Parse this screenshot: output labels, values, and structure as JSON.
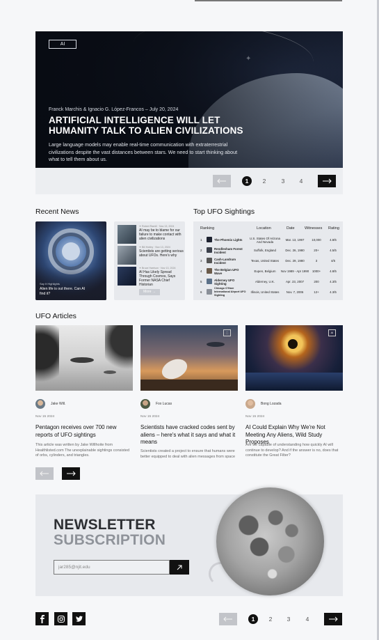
{
  "hero": {
    "tag": "AI",
    "byline": "Franck Marchis & Ignacio G. López-Francos – July 20, 2024",
    "title": "ARTIFICIAL INTELLIGENCE WILL LET HUMANITY TALK TO ALIEN CIVILIZATIONS",
    "description": "Large language models may enable real-time communication with extraterrestrial civilizations despite the vast distances between stars. We need to start thinking about what to tell them about us."
  },
  "pager_top": {
    "pages": [
      "1",
      "2",
      "3",
      "4"
    ],
    "active": "1"
  },
  "recent_news": {
    "title": "Recent News",
    "main": {
      "meta": "Say It Highlights",
      "title": "Alien life is out there. Can AI find it?"
    },
    "items": [
      {
        "meta": "✦ Robert Ramili · Nov 13, 2024",
        "title": "AI may be to blame for our failure to make contact with alien civilizations"
      },
      {
        "meta": "✦ Bill Hobby · Nov 13, 2024",
        "title": "Scientists are getting serious about UFOs. Here's why"
      },
      {
        "meta": "✦ Bruce Harrison · Nov 13, 2024",
        "title": "AI Has Likely Spread Through Cosmos, Says Former NASA Chief Historian"
      }
    ],
    "more_label": "More →"
  },
  "top_ufo": {
    "title": "Top UFO Sightings",
    "headers": {
      "ranking": "Ranking",
      "location": "Location",
      "date": "Date",
      "witnesses": "Witnesses",
      "rating": "Rating"
    },
    "rows": [
      {
        "num": "1",
        "name": "The Phoenix Lights",
        "location": "U.S. States Of Arizona And Nevada",
        "date": "Mar. 13, 1997",
        "witnesses": "10,000",
        "rating": "4.8/5"
      },
      {
        "num": "2",
        "name": "Rendlesham Forest Incident",
        "location": "Suffolk, England",
        "date": "Dec. 26, 1980",
        "witnesses": "20+",
        "rating": "4.5/5"
      },
      {
        "num": "3",
        "name": "Cash-Landrum Incident",
        "location": "Texas, United States",
        "date": "Dec. 29, 1980",
        "witnesses": "3",
        "rating": "4/5"
      },
      {
        "num": "4",
        "name": "The Belgian UFO Wave",
        "location": "Eupen, Belgium",
        "date": "Nov 1989 - Apr 1990",
        "witnesses": "1000+",
        "rating": "4.8/5"
      },
      {
        "num": "5",
        "name": "Alderney UFO Sighting",
        "location": "Alderney, U.K.",
        "date": "Apr. 23, 2007",
        "witnesses": "200",
        "rating": "4.3/5"
      },
      {
        "num": "6",
        "name": "Chicago O'Hare International Airport UFO Sighting",
        "location": "Illinois, United States",
        "date": "Nov. 7, 2006",
        "witnesses": "12+",
        "rating": "4.3/5"
      }
    ]
  },
  "articles": {
    "title": "UFO Articles",
    "items": [
      {
        "badge": "",
        "author": "Jake Will.",
        "date": "Nov 15 2024",
        "title": "Pentagon receives over 700 new reports of UFO sightings",
        "excerpt": "This article was written by Jake Willhoite from Healthlisted.com The unexplainable sightings consisted of orbs, cylinders, and triangles."
      },
      {
        "badge": "⬚",
        "author": "Fox Lucas",
        "date": "Nov 15 2024",
        "title": "Scientists have cracked codes sent by aliens – here's what it says and what it means",
        "excerpt": "Scientists created a project to ensure that humans were better equipped to deal with alien messages from space"
      },
      {
        "badge": "AI",
        "author": "Bong Lozada",
        "date": "Nov 15 2024",
        "title": "AI Could Explain Why We're Not Meeting Any Aliens, Wild Study Proposes",
        "excerpt": "Are we capable of understanding how quickly AI will continue to develop? And if the answer is no, does that constitute the Great Filter?"
      }
    ]
  },
  "newsletter": {
    "line1": "NEWSLETTER",
    "line2": "SUBSCRIPTION",
    "email_value": "jar285@njit.edu"
  },
  "pager_bottom": {
    "pages": [
      "1",
      "2",
      "3",
      "4"
    ],
    "active": "1"
  },
  "social": [
    "facebook-icon",
    "instagram-icon",
    "twitter-icon"
  ]
}
